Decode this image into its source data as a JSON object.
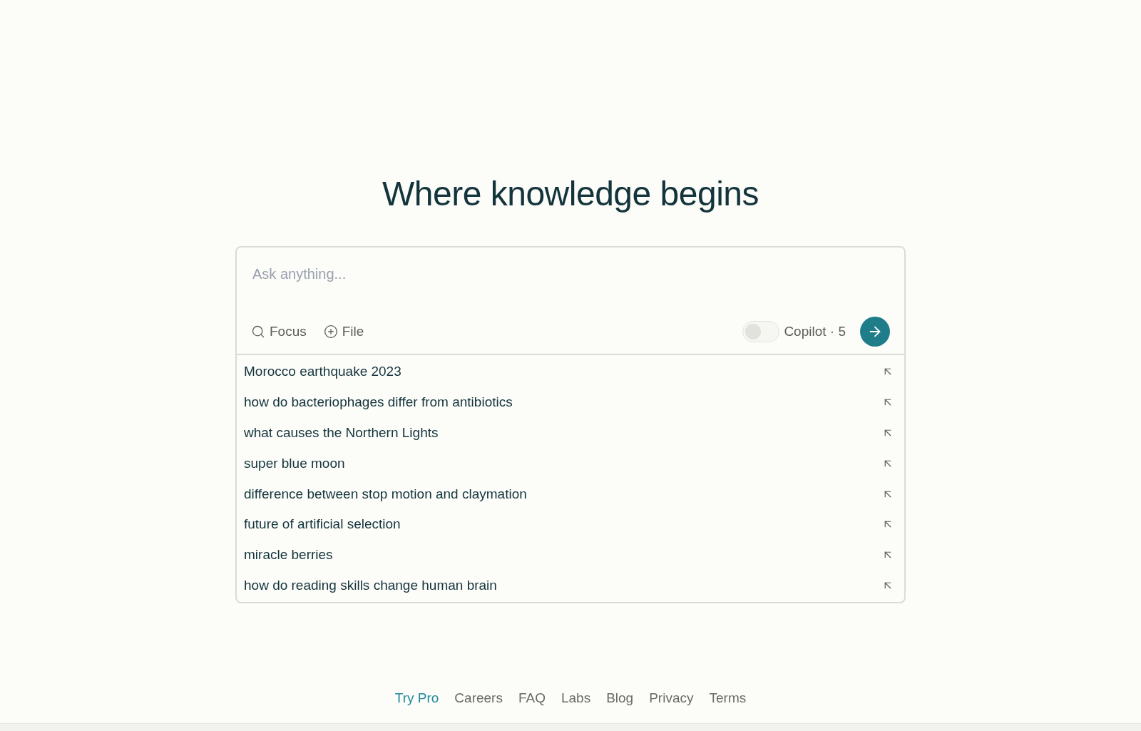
{
  "heading": "Where knowledge begins",
  "search": {
    "placeholder": "Ask anything...",
    "focus_label": "Focus",
    "file_label": "File",
    "copilot": {
      "label": "Copilot · 5",
      "on": false
    }
  },
  "suggestions": [
    {
      "text": "Morocco earthquake 2023"
    },
    {
      "text": "how do bacteriophages differ from antibiotics"
    },
    {
      "text": "what causes the Northern Lights"
    },
    {
      "text": "super blue moon"
    },
    {
      "text": "difference between stop motion and claymation"
    },
    {
      "text": "future of artificial selection"
    },
    {
      "text": "miracle berries"
    },
    {
      "text": "how do reading skills change human brain"
    }
  ],
  "footer_links": [
    {
      "label": "Try Pro",
      "highlighted": true
    },
    {
      "label": "Careers",
      "highlighted": false
    },
    {
      "label": "FAQ",
      "highlighted": false
    },
    {
      "label": "Labs",
      "highlighted": false
    },
    {
      "label": "Blog",
      "highlighted": false
    },
    {
      "label": "Privacy",
      "highlighted": false
    },
    {
      "label": "Terms",
      "highlighted": false
    }
  ]
}
